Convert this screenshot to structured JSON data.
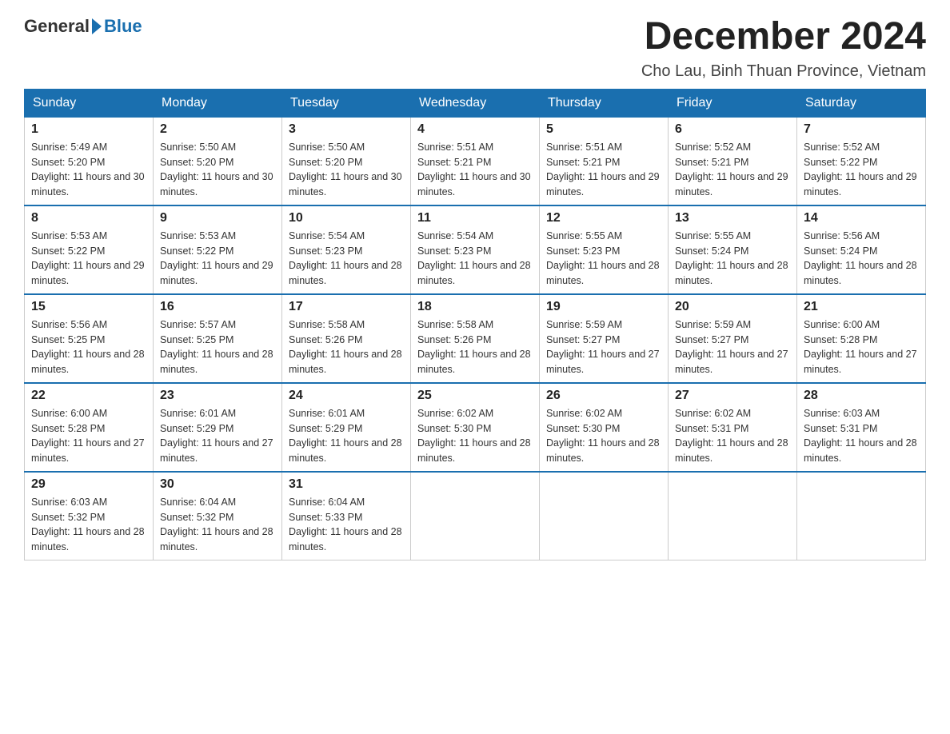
{
  "logo": {
    "general": "General",
    "blue": "Blue"
  },
  "title": "December 2024",
  "location": "Cho Lau, Binh Thuan Province, Vietnam",
  "headers": [
    "Sunday",
    "Monday",
    "Tuesday",
    "Wednesday",
    "Thursday",
    "Friday",
    "Saturday"
  ],
  "weeks": [
    [
      {
        "day": "1",
        "sunrise": "5:49 AM",
        "sunset": "5:20 PM",
        "daylight": "11 hours and 30 minutes."
      },
      {
        "day": "2",
        "sunrise": "5:50 AM",
        "sunset": "5:20 PM",
        "daylight": "11 hours and 30 minutes."
      },
      {
        "day": "3",
        "sunrise": "5:50 AM",
        "sunset": "5:20 PM",
        "daylight": "11 hours and 30 minutes."
      },
      {
        "day": "4",
        "sunrise": "5:51 AM",
        "sunset": "5:21 PM",
        "daylight": "11 hours and 30 minutes."
      },
      {
        "day": "5",
        "sunrise": "5:51 AM",
        "sunset": "5:21 PM",
        "daylight": "11 hours and 29 minutes."
      },
      {
        "day": "6",
        "sunrise": "5:52 AM",
        "sunset": "5:21 PM",
        "daylight": "11 hours and 29 minutes."
      },
      {
        "day": "7",
        "sunrise": "5:52 AM",
        "sunset": "5:22 PM",
        "daylight": "11 hours and 29 minutes."
      }
    ],
    [
      {
        "day": "8",
        "sunrise": "5:53 AM",
        "sunset": "5:22 PM",
        "daylight": "11 hours and 29 minutes."
      },
      {
        "day": "9",
        "sunrise": "5:53 AM",
        "sunset": "5:22 PM",
        "daylight": "11 hours and 29 minutes."
      },
      {
        "day": "10",
        "sunrise": "5:54 AM",
        "sunset": "5:23 PM",
        "daylight": "11 hours and 28 minutes."
      },
      {
        "day": "11",
        "sunrise": "5:54 AM",
        "sunset": "5:23 PM",
        "daylight": "11 hours and 28 minutes."
      },
      {
        "day": "12",
        "sunrise": "5:55 AM",
        "sunset": "5:23 PM",
        "daylight": "11 hours and 28 minutes."
      },
      {
        "day": "13",
        "sunrise": "5:55 AM",
        "sunset": "5:24 PM",
        "daylight": "11 hours and 28 minutes."
      },
      {
        "day": "14",
        "sunrise": "5:56 AM",
        "sunset": "5:24 PM",
        "daylight": "11 hours and 28 minutes."
      }
    ],
    [
      {
        "day": "15",
        "sunrise": "5:56 AM",
        "sunset": "5:25 PM",
        "daylight": "11 hours and 28 minutes."
      },
      {
        "day": "16",
        "sunrise": "5:57 AM",
        "sunset": "5:25 PM",
        "daylight": "11 hours and 28 minutes."
      },
      {
        "day": "17",
        "sunrise": "5:58 AM",
        "sunset": "5:26 PM",
        "daylight": "11 hours and 28 minutes."
      },
      {
        "day": "18",
        "sunrise": "5:58 AM",
        "sunset": "5:26 PM",
        "daylight": "11 hours and 28 minutes."
      },
      {
        "day": "19",
        "sunrise": "5:59 AM",
        "sunset": "5:27 PM",
        "daylight": "11 hours and 27 minutes."
      },
      {
        "day": "20",
        "sunrise": "5:59 AM",
        "sunset": "5:27 PM",
        "daylight": "11 hours and 27 minutes."
      },
      {
        "day": "21",
        "sunrise": "6:00 AM",
        "sunset": "5:28 PM",
        "daylight": "11 hours and 27 minutes."
      }
    ],
    [
      {
        "day": "22",
        "sunrise": "6:00 AM",
        "sunset": "5:28 PM",
        "daylight": "11 hours and 27 minutes."
      },
      {
        "day": "23",
        "sunrise": "6:01 AM",
        "sunset": "5:29 PM",
        "daylight": "11 hours and 27 minutes."
      },
      {
        "day": "24",
        "sunrise": "6:01 AM",
        "sunset": "5:29 PM",
        "daylight": "11 hours and 28 minutes."
      },
      {
        "day": "25",
        "sunrise": "6:02 AM",
        "sunset": "5:30 PM",
        "daylight": "11 hours and 28 minutes."
      },
      {
        "day": "26",
        "sunrise": "6:02 AM",
        "sunset": "5:30 PM",
        "daylight": "11 hours and 28 minutes."
      },
      {
        "day": "27",
        "sunrise": "6:02 AM",
        "sunset": "5:31 PM",
        "daylight": "11 hours and 28 minutes."
      },
      {
        "day": "28",
        "sunrise": "6:03 AM",
        "sunset": "5:31 PM",
        "daylight": "11 hours and 28 minutes."
      }
    ],
    [
      {
        "day": "29",
        "sunrise": "6:03 AM",
        "sunset": "5:32 PM",
        "daylight": "11 hours and 28 minutes."
      },
      {
        "day": "30",
        "sunrise": "6:04 AM",
        "sunset": "5:32 PM",
        "daylight": "11 hours and 28 minutes."
      },
      {
        "day": "31",
        "sunrise": "6:04 AM",
        "sunset": "5:33 PM",
        "daylight": "11 hours and 28 minutes."
      },
      null,
      null,
      null,
      null
    ]
  ]
}
